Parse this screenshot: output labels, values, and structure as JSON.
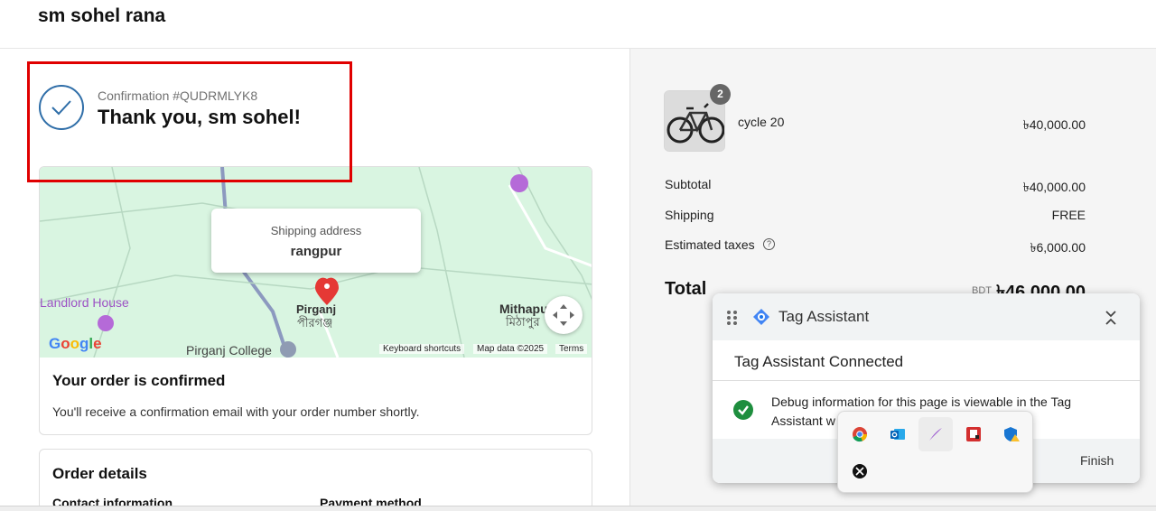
{
  "header": {
    "store_name": "sm sohel rana"
  },
  "confirmation": {
    "number_text": "Confirmation #QUDRMLYK8",
    "thank_you": "Thank you, sm sohel!"
  },
  "map": {
    "shipping_label": "Shipping address",
    "shipping_value": "rangpur",
    "places": [
      "Landlord House",
      "Pirganj",
      "পীরগঞ্জ",
      "Mithapu",
      "মিঠাপুর",
      "Pirganj College"
    ],
    "footer": {
      "shortcuts": "Keyboard shortcuts",
      "map_data": "Map data ©2025",
      "terms": "Terms"
    },
    "logo": "Google"
  },
  "order_confirmed": {
    "title": "Your order is confirmed",
    "text": "You'll receive a confirmation email with your order number shortly."
  },
  "order_details": {
    "title": "Order details",
    "contact_label": "Contact information",
    "payment_label": "Payment method"
  },
  "summary": {
    "item": {
      "name": "cycle 20",
      "quantity": "2",
      "price": "৳40,000.00"
    },
    "subtotal_label": "Subtotal",
    "subtotal": "৳40,000.00",
    "shipping_label": "Shipping",
    "shipping": "FREE",
    "taxes_label": "Estimated taxes",
    "taxes": "৳6,000.00",
    "total_label": "Total",
    "total_currency": "BDT",
    "total": "৳46,000.00"
  },
  "tag_assistant": {
    "title": "Tag Assistant",
    "connected": "Tag Assistant Connected",
    "debug_text": "Debug information for this page is viewable in the Tag Assistant w",
    "finish": "Finish"
  },
  "tray": {
    "icons": [
      "chrome-icon",
      "outlook-icon",
      "feather-pen-icon",
      "red-app-icon",
      "shield-warning-icon",
      "xbox-icon"
    ]
  },
  "colors": {
    "accent_blue": "#2f6ea8",
    "highlight_red": "#e00000",
    "map_green": "#d9f5e1",
    "success_green": "#1e8e3e"
  }
}
